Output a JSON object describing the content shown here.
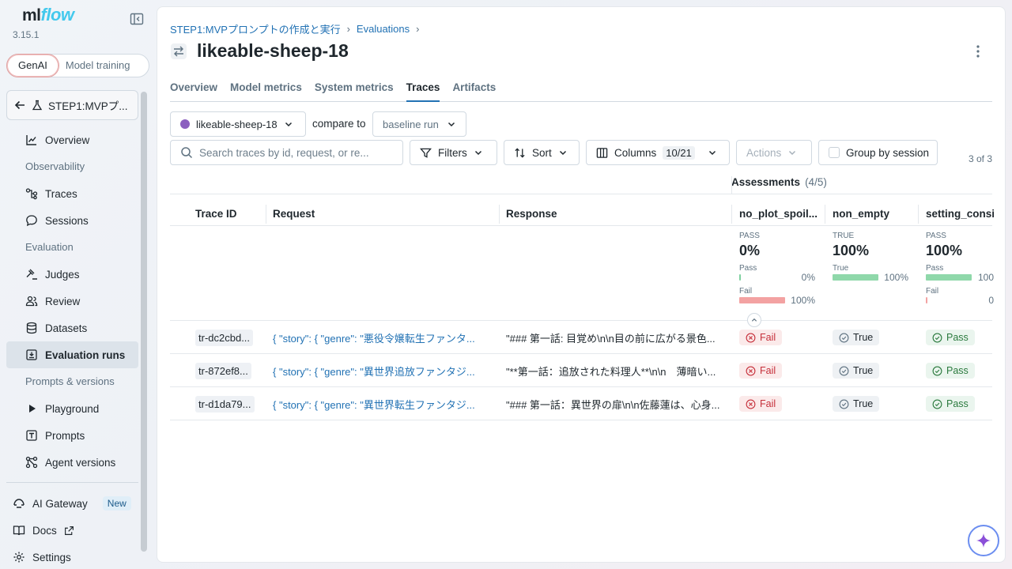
{
  "brand": {
    "ml": "ml",
    "flow": "flow",
    "version": "3.15.1"
  },
  "mode_switch": {
    "genai": "GenAI",
    "model_training": "Model training"
  },
  "experiment": {
    "name": "STEP1:MVPプ..."
  },
  "nav": {
    "overview": "Overview",
    "observability": "Observability",
    "traces": "Traces",
    "sessions": "Sessions",
    "evaluation": "Evaluation",
    "judges": "Judges",
    "review": "Review",
    "datasets": "Datasets",
    "evaluation_runs": "Evaluation runs",
    "prompts_versions": "Prompts & versions",
    "playground": "Playground",
    "prompts": "Prompts",
    "agent_versions": "Agent versions",
    "ai_gateway": "AI Gateway",
    "new_badge": "New",
    "docs": "Docs",
    "settings": "Settings"
  },
  "breadcrumb": {
    "experiment": "STEP1:MVPプロンプトの作成と実行",
    "section": "Evaluations",
    "sep": "›"
  },
  "run": {
    "title": "likeable-sheep-18"
  },
  "tabs": [
    "Overview",
    "Model metrics",
    "System metrics",
    "Traces",
    "Artifacts"
  ],
  "compare": {
    "run": "likeable-sheep-18",
    "label": "compare to",
    "baseline": "baseline run"
  },
  "toolbar": {
    "search_placeholder": "Search traces by id, request, or re...",
    "filters": "Filters",
    "sort": "Sort",
    "columns": "Columns",
    "columns_count": "10/21",
    "actions": "Actions",
    "group_by_session": "Group by session",
    "result_count": "3 of 3"
  },
  "assessments": {
    "label": "Assessments",
    "count": "(4/5)"
  },
  "columns": {
    "trace_id": "Trace ID",
    "request": "Request",
    "response": "Response",
    "a1": "no_plot_spoil...",
    "a2": "non_empty",
    "a3": "setting_consi"
  },
  "stats": {
    "a1": {
      "kind": "PASS",
      "pct": "0%",
      "l1": "Pass",
      "v1": "0%",
      "l2": "Fail",
      "v2": "100%"
    },
    "a2": {
      "kind": "TRUE",
      "pct": "100%",
      "l1": "True",
      "v1": "100%"
    },
    "a3": {
      "kind": "PASS",
      "pct": "100%",
      "l1": "Pass",
      "v1": "100",
      "l2": "Fail",
      "v2": "0"
    }
  },
  "rows": [
    {
      "id": "tr-dc2cbd...",
      "request": "{ \"story\": { \"genre\": \"悪役令嬢転生ファンタ...",
      "response": "\"### 第一話: 目覚め\\n\\n目の前に広がる景色...",
      "a1": "Fail",
      "a2": "True",
      "a3": "Pass"
    },
    {
      "id": "tr-872ef8...",
      "request": "{ \"story\": { \"genre\": \"異世界追放ファンタジ...",
      "response": "\"**第一話：追放された料理人**\\n\\n　薄暗い...",
      "a1": "Fail",
      "a2": "True",
      "a3": "Pass"
    },
    {
      "id": "tr-d1da79...",
      "request": "{ \"story\": { \"genre\": \"異世界転生ファンタジ...",
      "response": "\"### 第一話：異世界の扉\\n\\n佐藤蓮は、心身...",
      "a1": "Fail",
      "a2": "True",
      "a3": "Pass"
    }
  ],
  "colors": {
    "accent": "#2272b4",
    "fail": "#c6303b",
    "pass": "#2b7a3e",
    "run_dot": "#8b5fbf"
  }
}
